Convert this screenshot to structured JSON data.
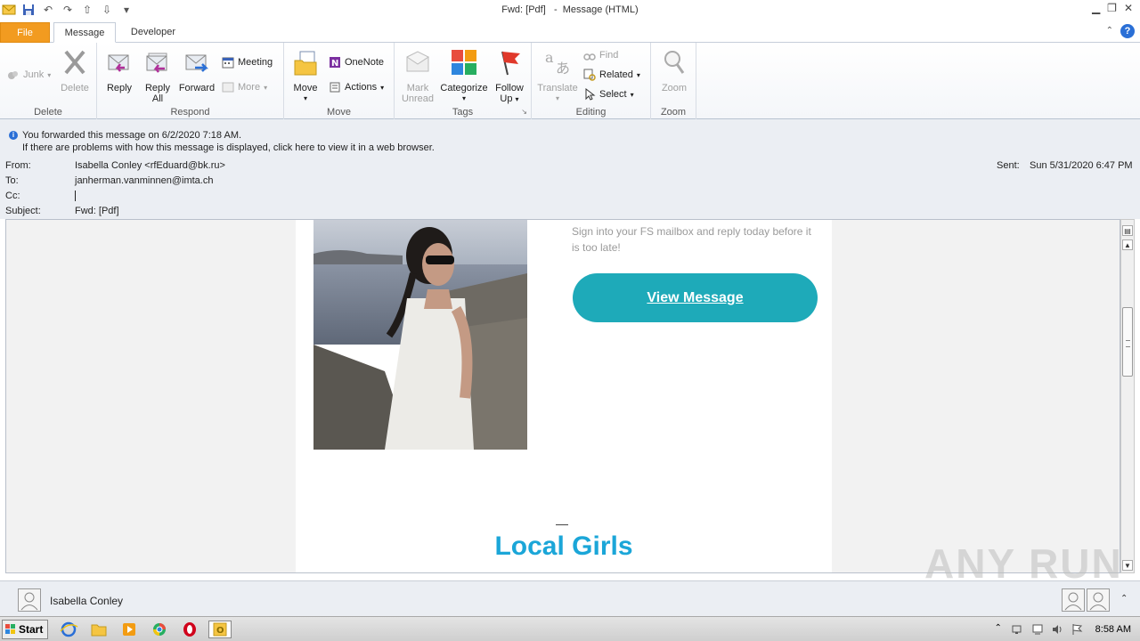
{
  "window": {
    "title": "Fwd: [Pdf]",
    "subtitle": "Message (HTML)"
  },
  "tabs": [
    {
      "label": "File"
    },
    {
      "label": "Message"
    },
    {
      "label": "Developer"
    }
  ],
  "ribbon": {
    "groups": {
      "delete": "Delete",
      "respond": "Respond",
      "move": "Move",
      "tags": "Tags",
      "editing": "Editing",
      "zoom": "Zoom"
    },
    "buttons": {
      "junk": "Junk",
      "delete": "Delete",
      "reply": "Reply",
      "reply_all_1": "Reply",
      "reply_all_2": "All",
      "forward": "Forward",
      "meeting": "Meeting",
      "more": "More",
      "move": "Move",
      "onenote": "OneNote",
      "actions": "Actions",
      "mark_unread_1": "Mark",
      "mark_unread_2": "Unread",
      "categorize": "Categorize",
      "follow_up_1": "Follow",
      "follow_up_2": "Up",
      "translate": "Translate",
      "find": "Find",
      "related": "Related",
      "select": "Select",
      "zoom": "Zoom"
    }
  },
  "info": {
    "forwarded_notice": "You forwarded this message on 6/2/2020 7:18 AM.",
    "browser_notice": "If there are problems with how this message is displayed, click here to view it in a web browser."
  },
  "header": {
    "from_label": "From:",
    "from_value": "Isabella Conley <rfEduard@bk.ru>",
    "to_label": "To:",
    "to_value": "janherman.vanminnen@imta.ch",
    "cc_label": "Cc:",
    "cc_value": "",
    "subject_label": "Subject:",
    "subject_value": "Fwd: [Pdf]",
    "sent_label": "Sent:",
    "sent_value": "Sun 5/31/2020 6:47 PM"
  },
  "email": {
    "message_text": "Sign into your FS mailbox and reply today before it is too late!",
    "view_button": "View Message",
    "heading": "Local Girls"
  },
  "people_pane": {
    "name": "Isabella Conley"
  },
  "watermark": "ANY RUN",
  "taskbar": {
    "start": "Start",
    "clock": "8:58 AM"
  }
}
